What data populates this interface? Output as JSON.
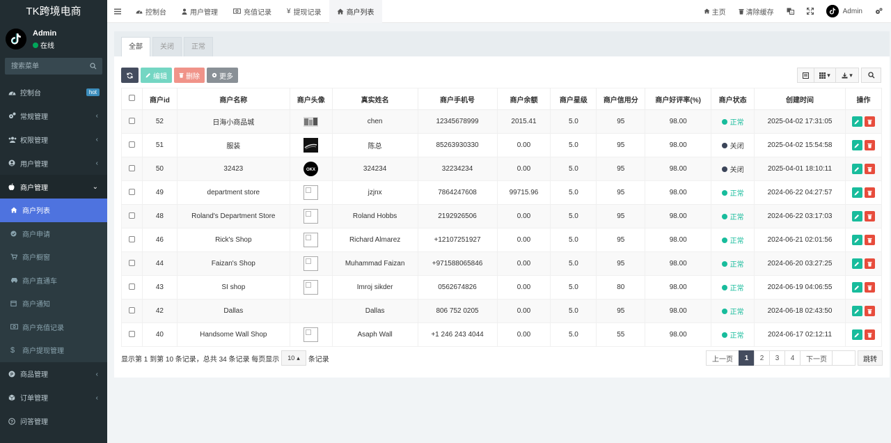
{
  "brand": "TK跨境电商",
  "user": {
    "name": "Admin",
    "status": "在线"
  },
  "sidebar": {
    "search_placeholder": "搜索菜单",
    "items": [
      {
        "label": "控制台",
        "badge": "hot"
      },
      {
        "label": "常规管理"
      },
      {
        "label": "权限管理"
      },
      {
        "label": "用户管理"
      },
      {
        "label": "商户管理"
      }
    ],
    "submenu": [
      {
        "label": "商户列表"
      },
      {
        "label": "商户申请"
      },
      {
        "label": "商户橱窗"
      },
      {
        "label": "商户直通车"
      },
      {
        "label": "商户通知"
      },
      {
        "label": "商户充值记录"
      },
      {
        "label": "商户提现管理"
      }
    ],
    "items_after": [
      {
        "label": "商品管理"
      },
      {
        "label": "订单管理"
      },
      {
        "label": "问答管理"
      }
    ]
  },
  "topbar": {
    "tabs": [
      "控制台",
      "用户管理",
      "充值记录",
      "提现记录",
      "商户列表"
    ],
    "home": "主页",
    "clear_cache": "清除缓存",
    "admin": "Admin"
  },
  "panel": {
    "tabs": [
      "全部",
      "关闭",
      "正常"
    ]
  },
  "toolbar": {
    "edit": "编辑",
    "delete": "删除",
    "more": "更多"
  },
  "table": {
    "columns": [
      "商户id",
      "商户名称",
      "商户头像",
      "真实姓名",
      "商户手机号",
      "商户余额",
      "商户星级",
      "商户信用分",
      "商户好评率(%)",
      "商户状态",
      "创建时间",
      "操作"
    ],
    "rows": [
      {
        "id": "52",
        "name": "日海小商品城",
        "avatar": "photo-a",
        "realname": "chen",
        "phone": "12345678999",
        "balance": "2015.41",
        "star": "5.0",
        "credit": "95",
        "rate": "98.00",
        "status": "正常",
        "created": "2025-04-02 17:31:05"
      },
      {
        "id": "51",
        "name": "服装",
        "avatar": "photo-b",
        "realname": "陈总",
        "phone": "85263930330",
        "balance": "0.00",
        "star": "5.0",
        "credit": "95",
        "rate": "98.00",
        "status": "关闭",
        "created": "2025-04-02 15:54:58"
      },
      {
        "id": "50",
        "name": "32423",
        "avatar": "photo-c",
        "realname": "324234",
        "phone": "32234234",
        "balance": "0.00",
        "star": "5.0",
        "credit": "95",
        "rate": "98.00",
        "status": "关闭",
        "created": "2025-04-01 18:10:11"
      },
      {
        "id": "49",
        "name": "department store",
        "avatar": "broken",
        "realname": "jzjnx",
        "phone": "7864247608",
        "balance": "99715.96",
        "star": "5.0",
        "credit": "95",
        "rate": "98.00",
        "status": "正常",
        "created": "2024-06-22 04:27:57"
      },
      {
        "id": "48",
        "name": "Roland's Department Store",
        "avatar": "broken",
        "realname": "Roland Hobbs",
        "phone": "2192926506",
        "balance": "0.00",
        "star": "5.0",
        "credit": "95",
        "rate": "98.00",
        "status": "正常",
        "created": "2024-06-22 03:17:03"
      },
      {
        "id": "46",
        "name": "Rick's Shop",
        "avatar": "broken",
        "realname": "Richard Almarez",
        "phone": "+12107251927",
        "balance": "0.00",
        "star": "5.0",
        "credit": "95",
        "rate": "98.00",
        "status": "正常",
        "created": "2024-06-21 02:01:56"
      },
      {
        "id": "44",
        "name": "Faizan's Shop",
        "avatar": "broken",
        "realname": "Muhammad Faizan",
        "phone": "+971588065846",
        "balance": "0.00",
        "star": "5.0",
        "credit": "95",
        "rate": "98.00",
        "status": "正常",
        "created": "2024-06-20 03:27:25"
      },
      {
        "id": "43",
        "name": "SI shop",
        "avatar": "broken",
        "realname": "Imroj sikder",
        "phone": "0562674826",
        "balance": "0.00",
        "star": "5.0",
        "credit": "80",
        "rate": "98.00",
        "status": "正常",
        "created": "2024-06-19 04:06:55"
      },
      {
        "id": "42",
        "name": "Dallas",
        "avatar": "none",
        "realname": "Dallas",
        "phone": "806 752 0205",
        "balance": "0.00",
        "star": "5.0",
        "credit": "95",
        "rate": "98.00",
        "status": "正常",
        "created": "2024-06-18 02:43:50"
      },
      {
        "id": "40",
        "name": "Handsome Wall Shop",
        "avatar": "broken",
        "realname": "Asaph Wall",
        "phone": "+1 246 243 4044",
        "balance": "0.00",
        "star": "5.0",
        "credit": "55",
        "rate": "98.00",
        "status": "正常",
        "created": "2024-06-17 02:12:11"
      }
    ]
  },
  "footer": {
    "info_prefix": "显示第 1 到第 10 条记录，总共 34 条记录 每页显示",
    "page_size": "10",
    "info_suffix": "条记录",
    "prev": "上一页",
    "pages": [
      "1",
      "2",
      "3",
      "4"
    ],
    "next": "下一页",
    "jump": "跳转"
  },
  "colors": {
    "sidebar": "#222d32",
    "active": "#4e73df",
    "success": "#18bc9c",
    "danger": "#e74c3c"
  }
}
